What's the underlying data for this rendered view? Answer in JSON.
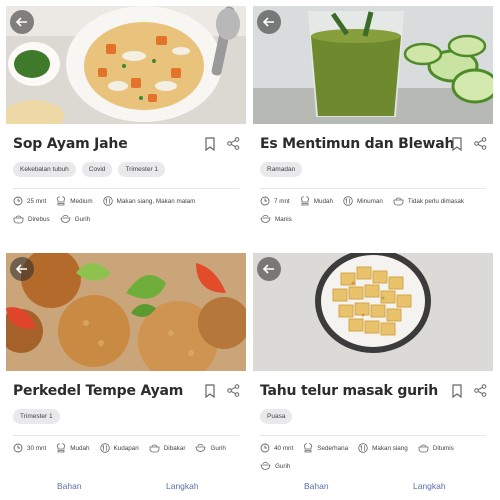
{
  "cards": [
    {
      "title": "Sop Ayam Jahe",
      "tags": [
        "Kekebalan tubuh",
        "Covid",
        "Trimester 1"
      ],
      "meta": [
        "25 mnt",
        "Medium",
        "Makan siang, Makan malam",
        "Direbus",
        "Gurih"
      ]
    },
    {
      "title": "Es Mentimun dan Blewah",
      "tags": [
        "Ramadan"
      ],
      "meta": [
        "7 mnt",
        "Mudah",
        "Minuman",
        "Tidak perlu dimasak",
        "Manis"
      ]
    },
    {
      "title": "Perkedel Tempe Ayam",
      "tags": [
        "Trimester 1"
      ],
      "meta": [
        "30 mnt",
        "Mudah",
        "Kudapan",
        "Dibakar",
        "Gurih"
      ]
    },
    {
      "title": "Tahu telur masak gurih",
      "tags": [
        "Puasa"
      ],
      "meta": [
        "40 mnt",
        "Sederhana",
        "Makan siang",
        "Ditumis",
        "Gurih"
      ]
    }
  ],
  "tabs": {
    "bahan": "Bahan",
    "langkah": "Langkah",
    "bahan2": "Bahan",
    "langkah2": "Langkah"
  },
  "icons": {
    "back": "arrow-left-icon",
    "bookmark": "bookmark-icon",
    "share": "share-icon",
    "time": "clock-icon",
    "difficulty": "chef-hat-icon",
    "meal": "utensils-icon",
    "method": "pot-icon",
    "taste": "bowl-icon"
  },
  "colors": {
    "tab": "#5a6fb0",
    "tag_bg": "#e9e9ec",
    "title": "#2c2c2c"
  }
}
